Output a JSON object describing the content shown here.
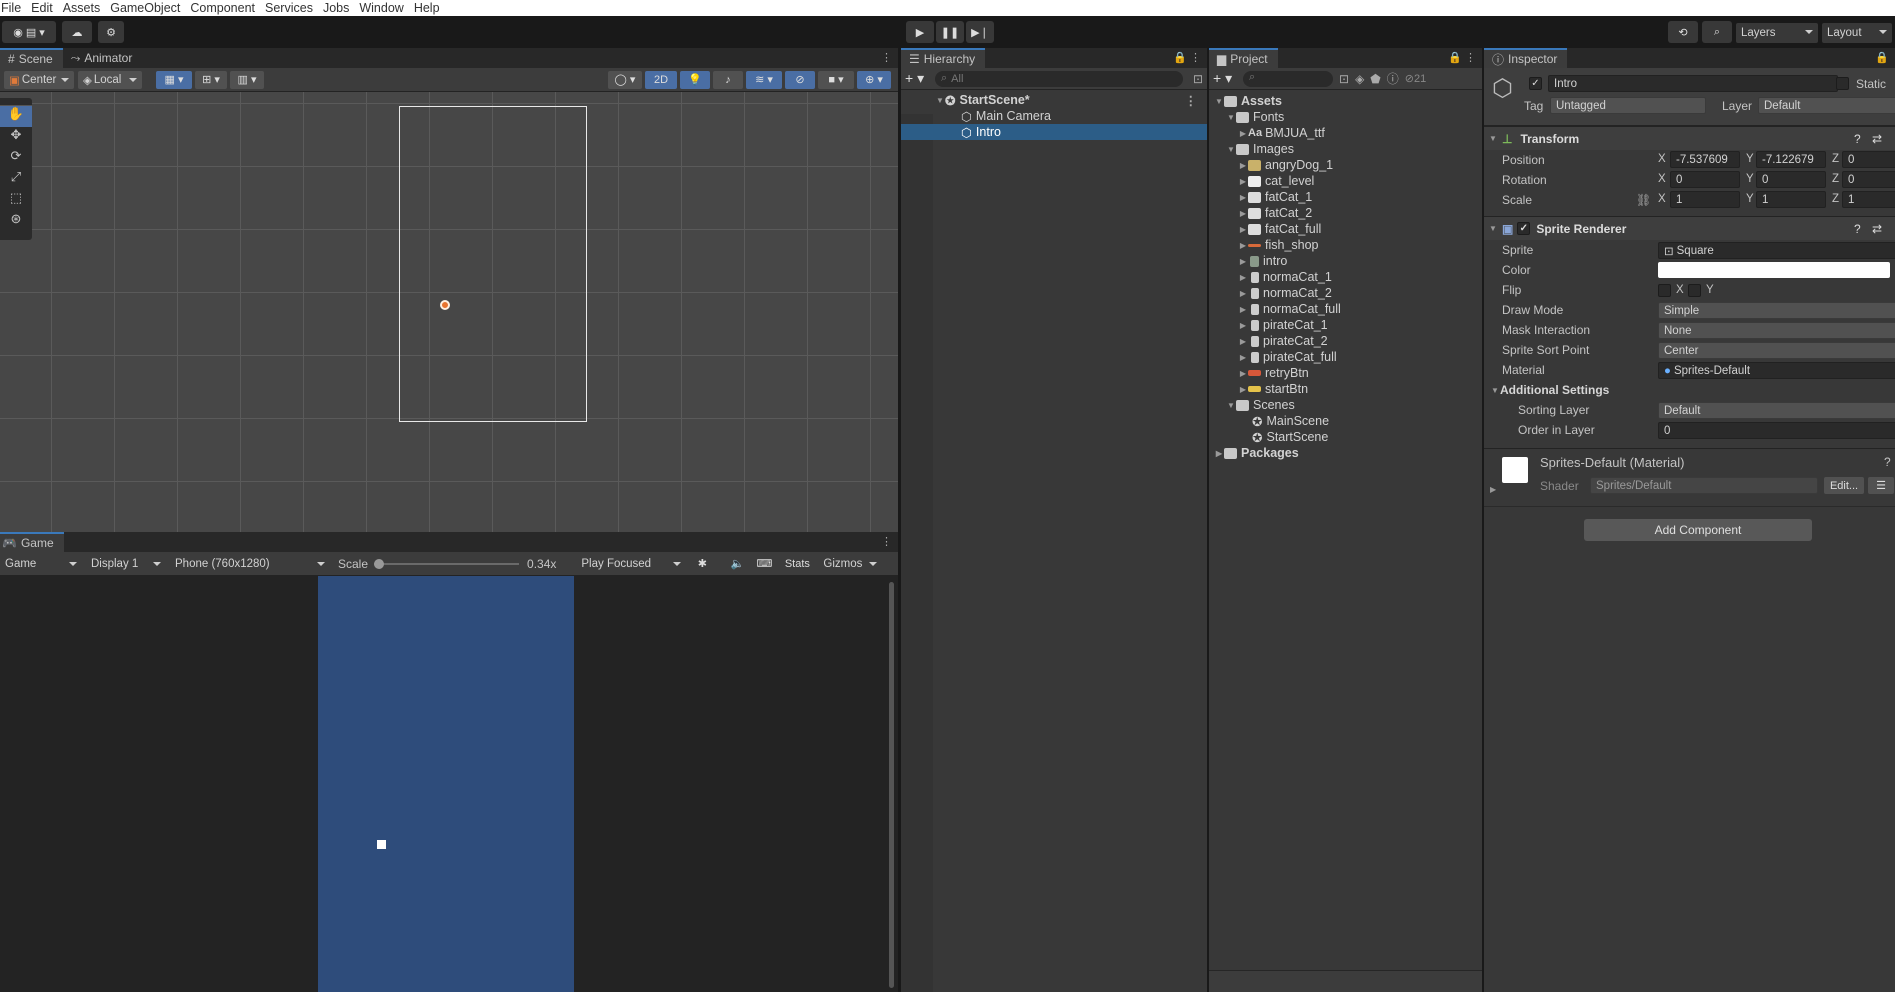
{
  "menu": [
    "File",
    "Edit",
    "Assets",
    "GameObject",
    "Component",
    "Services",
    "Jobs",
    "Window",
    "Help"
  ],
  "toolbar": {
    "layers": "Layers",
    "layout": "Layout"
  },
  "scene": {
    "tabs": [
      "Scene",
      "Animator"
    ],
    "pivot": "Center",
    "space": "Local",
    "mode_2d": "2D"
  },
  "game": {
    "tab": "Game",
    "view": "Game",
    "display": "Display 1",
    "resolution": "Phone (760x1280)",
    "scale_label": "Scale",
    "scale_value": "0.34x",
    "play_mode": "Play Focused",
    "stats": "Stats",
    "gizmos": "Gizmos",
    "bg_color": "#2e4c7b"
  },
  "hierarchy": {
    "tab": "Hierarchy",
    "search_placeholder": "All",
    "scene": "StartScene*",
    "items": [
      "Main Camera",
      "Intro"
    ],
    "selected": "Intro"
  },
  "project": {
    "tab": "Project",
    "hidden_count": "21",
    "tree": {
      "assets": "Assets",
      "fonts": "Fonts",
      "font_items": [
        "BMJUA_ttf"
      ],
      "images": "Images",
      "image_items": [
        "angryDog_1",
        "cat_level",
        "fatCat_1",
        "fatCat_2",
        "fatCat_full",
        "fish_shop",
        "intro",
        "normaCat_1",
        "normaCat_2",
        "normaCat_full",
        "pirateCat_1",
        "pirateCat_2",
        "pirateCat_full",
        "retryBtn",
        "startBtn"
      ],
      "scenes": "Scenes",
      "scene_items": [
        "MainScene",
        "StartScene"
      ],
      "packages": "Packages"
    }
  },
  "inspector": {
    "tab": "Inspector",
    "name": "Intro",
    "static": "Static",
    "tag_label": "Tag",
    "tag": "Untagged",
    "layer_label": "Layer",
    "layer": "Default",
    "transform": {
      "title": "Transform",
      "position_label": "Position",
      "rotation_label": "Rotation",
      "scale_label": "Scale",
      "position": [
        "-7.537609",
        "-7.122679",
        "0"
      ],
      "rotation": [
        "0",
        "0",
        "0"
      ],
      "scale": [
        "1",
        "1",
        "1"
      ]
    },
    "sprite_renderer": {
      "title": "Sprite Renderer",
      "sprite_label": "Sprite",
      "sprite": "Square",
      "color_label": "Color",
      "flip_label": "Flip",
      "flip_x": "X",
      "flip_y": "Y",
      "draw_mode_label": "Draw Mode",
      "draw_mode": "Simple",
      "mask_label": "Mask Interaction",
      "mask": "None",
      "sort_point_label": "Sprite Sort Point",
      "sort_point": "Center",
      "material_label": "Material",
      "material": "Sprites-Default",
      "additional": "Additional Settings",
      "sorting_layer_label": "Sorting Layer",
      "sorting_layer": "Default",
      "order_label": "Order in Layer",
      "order": "0"
    },
    "material": {
      "title": "Sprites-Default (Material)",
      "shader_label": "Shader",
      "shader": "Sprites/Default",
      "edit": "Edit..."
    },
    "add_component": "Add Component"
  },
  "axes": {
    "x": "X",
    "y": "Y",
    "z": "Z"
  },
  "colors": {
    "selection": "#2c5d87",
    "accent": "#3a79bb"
  }
}
